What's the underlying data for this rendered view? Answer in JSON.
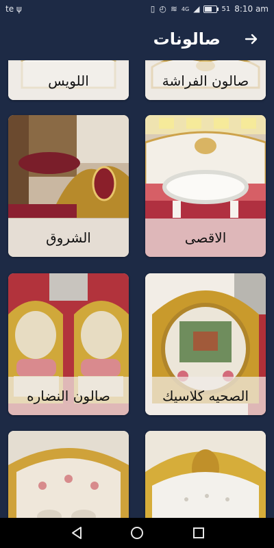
{
  "status_bar": {
    "left_text": "te ψ",
    "network": "4G",
    "battery_text": "51",
    "time": "8:10 am"
  },
  "header": {
    "title": "صالونات",
    "back_icon": "arrow-right-icon"
  },
  "cards": [
    {
      "label": "صالون الفراشة"
    },
    {
      "label": "اللويس"
    },
    {
      "label": "الاقصى"
    },
    {
      "label": "الشروق"
    },
    {
      "label": "الصحيه كلاسيك"
    },
    {
      "label": "صالون النضاره"
    },
    {
      "label": ""
    },
    {
      "label": ""
    }
  ],
  "nav": {
    "back": "triangle-back-icon",
    "home": "circle-home-icon",
    "recents": "square-recents-icon"
  },
  "colors": {
    "background": "#1d2a45",
    "label_overlay": "#f0ece8"
  }
}
